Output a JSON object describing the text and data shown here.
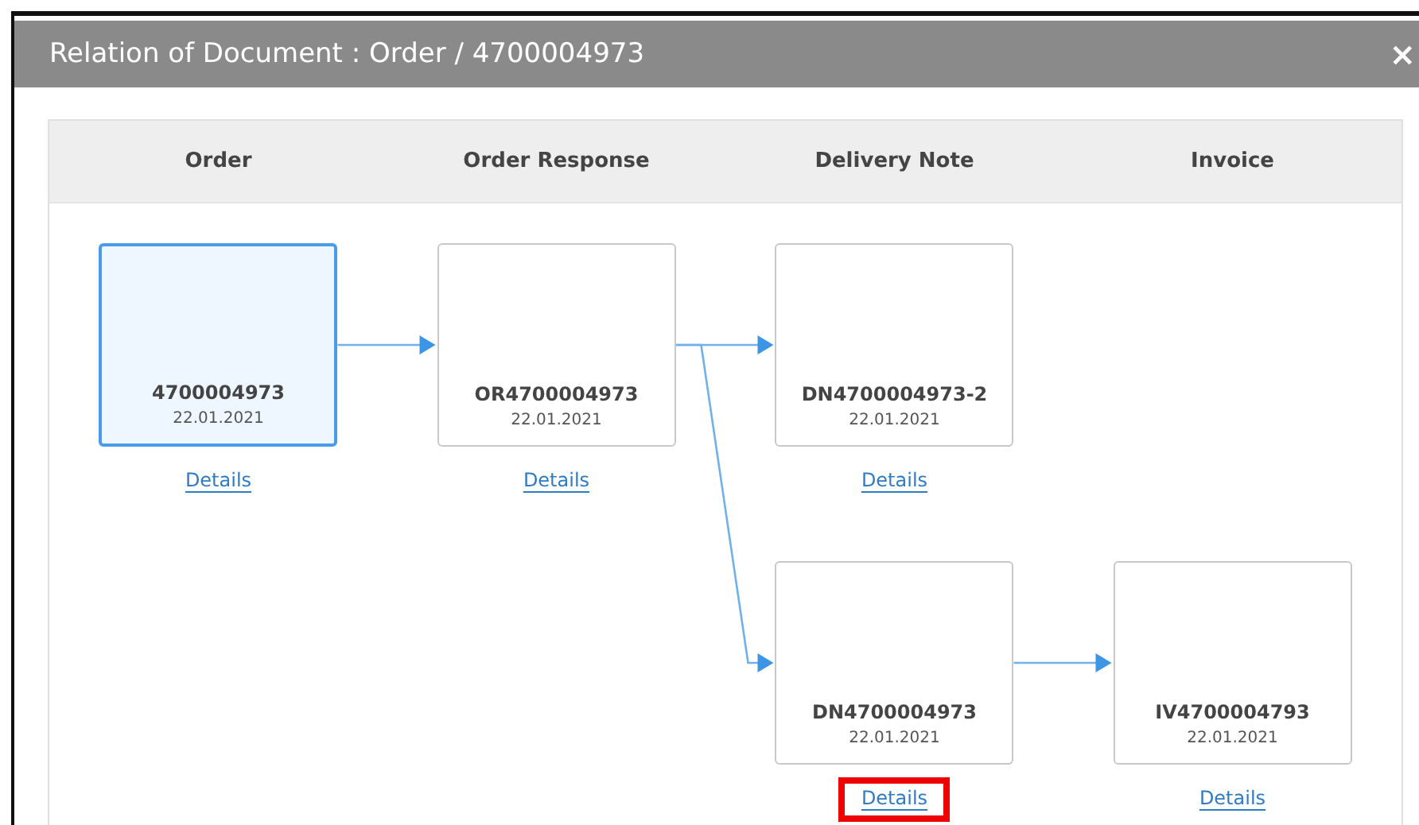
{
  "window": {
    "title": "Relation of Document : Order / 4700004973",
    "close": "×"
  },
  "columns": [
    "Order",
    "Order Response",
    "Delivery Note",
    "Invoice"
  ],
  "document_tree": [
    {
      "number": "4700004973",
      "date": "22.01.2021",
      "selected": true,
      "link": "Details",
      "link_highlighted": false,
      "children": [
        {
          "number": "OR4700004973",
          "date": "22.01.2021",
          "selected": false,
          "link": "Details",
          "link_highlighted": false,
          "children": [
            {
              "number": "DN4700004973-2",
              "date": "22.01.2021",
              "selected": false,
              "link": "Details",
              "link_highlighted": false
            },
            {
              "number": "DN4700004973",
              "date": "22.01.2021",
              "selected": false,
              "link": "Details",
              "link_highlighted": true,
              "children": [
                {
                  "number": "IV4700004793",
                  "date": "22.01.2021",
                  "selected": false,
                  "link": "Details",
                  "link_highlighted": false
                }
              ]
            }
          ]
        }
      ]
    }
  ]
}
